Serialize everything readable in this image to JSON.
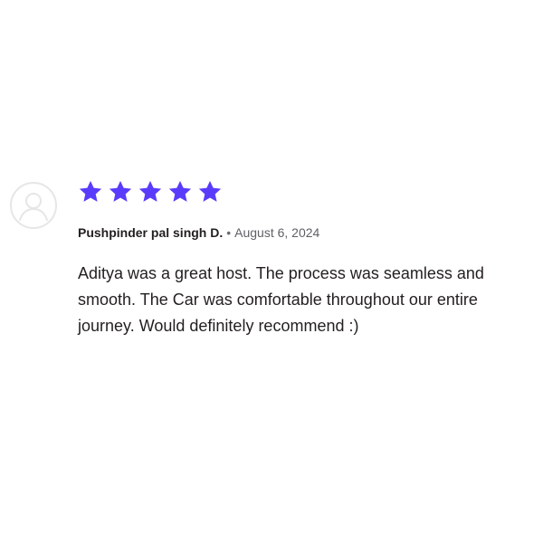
{
  "review": {
    "rating": 5,
    "rating_max": 5,
    "star_color": "#593cfb",
    "avatar_icon": "user-placeholder-icon",
    "author": "Pushpinder pal singh D.",
    "separator": "•",
    "date": "August 6, 2024",
    "text": "Aditya was a great host. The process was seamless and smooth. The Car was comfortable throughout our entire journey. Would definitely recommend :)"
  }
}
